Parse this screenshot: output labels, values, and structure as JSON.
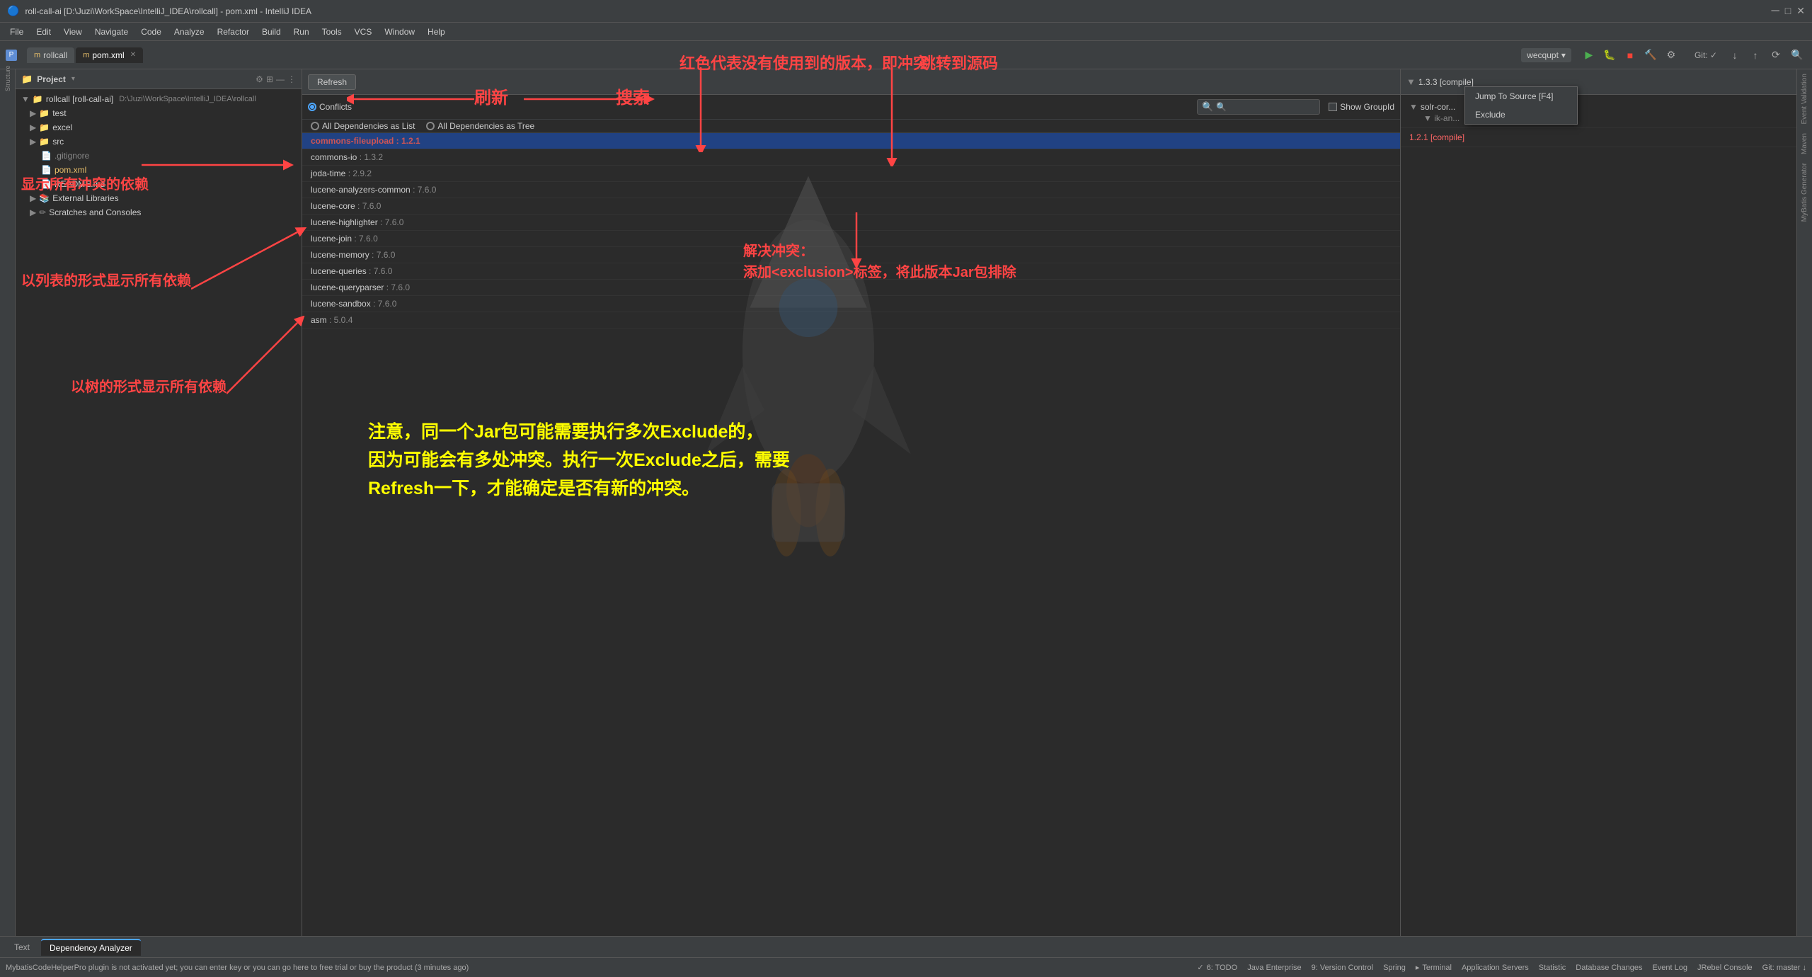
{
  "titlebar": {
    "title": "roll-call-ai [D:\\Juzi\\WorkSpace\\IntelliJ_IDEA\\rollcall] - pom.xml - IntelliJ IDEA",
    "icon": "🔵"
  },
  "menubar": {
    "items": [
      "File",
      "Edit",
      "View",
      "Navigate",
      "Code",
      "Analyze",
      "Refactor",
      "Build",
      "Run",
      "Tools",
      "VCS",
      "Window",
      "Help"
    ]
  },
  "toolbar": {
    "tabs": [
      {
        "label": "rollcall",
        "active": false
      },
      {
        "label": "pom.xml",
        "active": true
      }
    ],
    "git_branch": "Git: ✓",
    "user": "wecqupt"
  },
  "project_panel": {
    "title": "Project",
    "root": "rollcall [roll-call-ai]",
    "root_path": "D:\\Juzi\\WorkSpace\\IntelliJ_IDEA\\rollcall",
    "items": [
      {
        "label": "test",
        "type": "folder",
        "indent": 1
      },
      {
        "label": "excel",
        "type": "folder",
        "indent": 1
      },
      {
        "label": "src",
        "type": "folder",
        "indent": 1
      },
      {
        "label": ".gitignore",
        "type": "file",
        "indent": 2
      },
      {
        "label": "pom.xml",
        "type": "xml",
        "indent": 2
      },
      {
        "label": "README.md",
        "type": "file",
        "indent": 2
      },
      {
        "label": "External Libraries",
        "type": "folder",
        "indent": 1
      },
      {
        "label": "Scratches and Consoles",
        "type": "folder",
        "indent": 1
      }
    ]
  },
  "dep_analyzer": {
    "refresh_btn": "Refresh",
    "filter_conflicts": "Conflicts",
    "filter_all_list": "All Dependencies as List",
    "filter_all_tree": "All Dependencies as Tree",
    "search_placeholder": "🔍",
    "show_group_id": "Show GroupId",
    "dependencies": [
      {
        "name": "commons-fileupload",
        "version": "1.2.1",
        "conflict": true,
        "selected": true
      },
      {
        "name": "commons-io",
        "version": "1.3.2",
        "conflict": false
      },
      {
        "name": "joda-time",
        "version": "2.9.2",
        "conflict": false
      },
      {
        "name": "lucene-analyzers-common",
        "version": "7.6.0",
        "conflict": false
      },
      {
        "name": "lucene-core",
        "version": "7.6.0",
        "conflict": false
      },
      {
        "name": "lucene-highlighter",
        "version": "7.6.0",
        "conflict": false
      },
      {
        "name": "lucene-join",
        "version": "7.6.0",
        "conflict": false
      },
      {
        "name": "lucene-memory",
        "version": "7.6.0",
        "conflict": false
      },
      {
        "name": "lucene-queries",
        "version": "7.6.0",
        "conflict": false
      },
      {
        "name": "lucene-queryparser",
        "version": "7.6.0",
        "conflict": false
      },
      {
        "name": "lucene-sandbox",
        "version": "7.6.0",
        "conflict": false
      },
      {
        "name": "asm",
        "version": "5.0.4",
        "conflict": false
      }
    ]
  },
  "right_panel": {
    "header": "1.3.3 [compile]",
    "versions": [
      {
        "label": "solr-cor...",
        "version": "",
        "indent": 1
      },
      {
        "label": "ik-an...",
        "version": "",
        "indent": 2
      },
      {
        "label": "1.2.1 [compile]",
        "version": "",
        "indent": 1
      }
    ]
  },
  "context_menu": {
    "items": [
      {
        "label": "Jump To Source [F4]"
      },
      {
        "label": "Exclude"
      }
    ]
  },
  "annotations": {
    "refresh_label": "刷新",
    "search_label": "搜索",
    "jump_source_label": "跳转到源码",
    "conflicts_desc": "红色代表没有使用到的版本，即冲突",
    "show_conflicts": "显示所有冲突的依赖",
    "show_list": "以列表的形式显示所有依赖",
    "show_tree": "以树的形式显示所有依赖",
    "resolve_desc": "解决冲突：\n添加<exclusion>标签，将此版本Jar包排除",
    "notice": "注意，同一个Jar包可能需要执行多次Exclude的，\n因为可能会有多处冲突。执行一次Exclude之后，需要\nRefresh一下，才能确定是否有新的冲突。"
  },
  "bottom_tabs": {
    "items": [
      {
        "label": "Text",
        "active": false
      },
      {
        "label": "Dependency Analyzer",
        "active": true
      }
    ]
  },
  "statusbar": {
    "todo": "6: TODO",
    "java": "Java Enterprise",
    "version_control": "9: Version Control",
    "spring": "Spring",
    "terminal": "Terminal",
    "app_servers": "Application Servers",
    "statistic": "Statistic",
    "database": "Database Changes",
    "event_log": "Event Log",
    "jrebel": "JRebel Console",
    "git_master": "Git: master ↓",
    "mybatis_msg": "MybatisCodeHelperPro plugin is not activated yet; you can enter key or you can go here to free trial or buy the product (3 minutes ago)"
  }
}
